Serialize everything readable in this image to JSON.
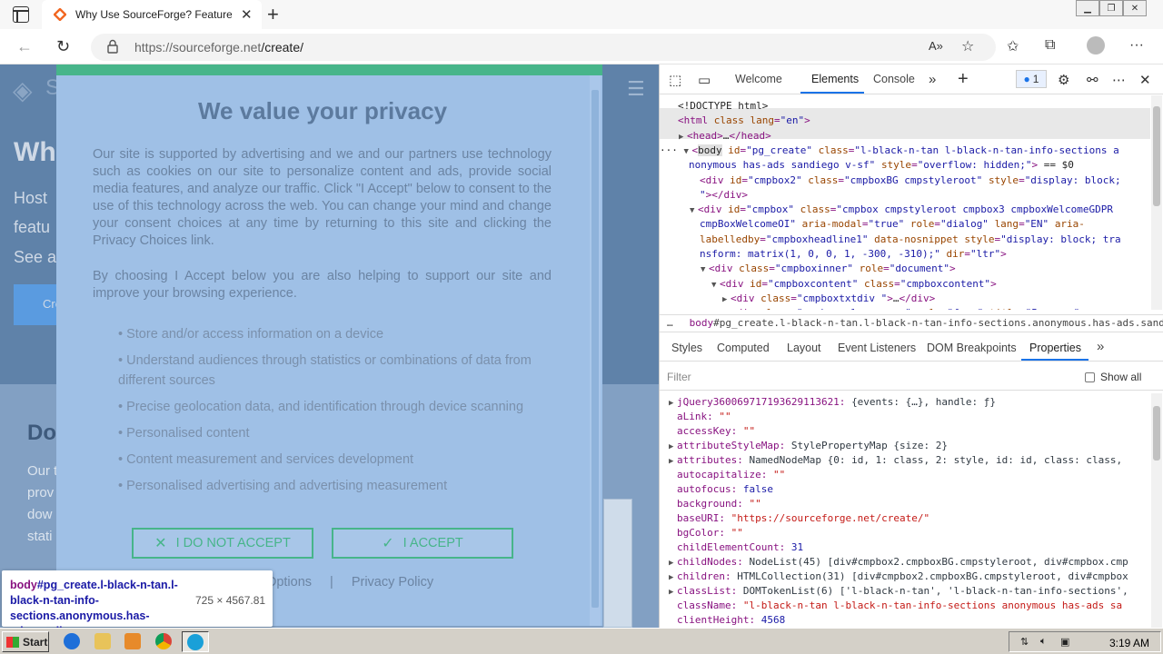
{
  "browser": {
    "tab_title": "Why Use SourceForge? Features a",
    "url_domain": "https://sourceforge.net",
    "url_path": "/create/"
  },
  "page_background": {
    "snippets": [
      "Wh",
      "Host",
      "featu",
      "See a",
      "Cre",
      "Do",
      "Our t",
      "prov",
      "dow",
      "stati",
      "S"
    ]
  },
  "consent": {
    "title": "We value your privacy",
    "paragraph1": "Our site is supported by advertising and we and our partners use technology such as cookies on our site to personalize content and ads, provide social media features, and analyze our traffic. Click \"I Accept\" below to consent to the use of this technology across the web. You can change your mind and change your consent choices at any time by returning to this site and clicking the Privacy Choices link.",
    "paragraph2": "By choosing I Accept below you are also helping to support our site and improve your browsing experience.",
    "purposes": [
      "Store and/or access information on a device",
      "Understand audiences through statistics or combinations of data from different sources",
      "Precise geolocation data, and identification through device scanning",
      "Personalised content",
      "Content measurement and services development",
      "Personalised advertising and advertising measurement"
    ],
    "reject_label": "I DO NOT ACCEPT",
    "accept_label": "I ACCEPT",
    "more_options": "More Options",
    "separator": "|",
    "privacy_policy": "Privacy Policy"
  },
  "inspect_tooltip": {
    "selector_tag": "body",
    "selector_rest": "#pg_create.l-black-n-tan.l-black-n-tan-info-sections.anonymous.has-ads.sandiego...",
    "dimensions": "725 × 4567.81"
  },
  "devtools": {
    "tabs": [
      "Welcome",
      "Elements",
      "Console"
    ],
    "active_tab": "Elements",
    "issues_count": "1",
    "dom_lines": [
      {
        "indent": 0,
        "arrow": "",
        "parts": [
          [
            "tx",
            "<!DOCTYPE html>"
          ]
        ]
      },
      {
        "indent": 0,
        "arrow": "",
        "parts": [
          [
            "tag",
            "<html "
          ],
          [
            "an",
            "class"
          ],
          [
            "tag",
            " "
          ],
          [
            "an",
            "lang"
          ],
          [
            "tag",
            "="
          ],
          [
            "av",
            "\"en\""
          ],
          [
            "tag",
            ">"
          ]
        ]
      },
      {
        "indent": 1,
        "arrow": "▶",
        "parts": [
          [
            "tag",
            "<head>"
          ],
          [
            "tx",
            "…"
          ],
          [
            "tag",
            "</head>"
          ]
        ]
      },
      {
        "indent": 1,
        "arrow": "▼",
        "parts": [
          [
            "tag",
            "<"
          ],
          [
            "hl",
            "body"
          ],
          [
            "tag",
            " "
          ],
          [
            "an",
            "id"
          ],
          [
            "tag",
            "="
          ],
          [
            "av",
            "\"pg_create\""
          ],
          [
            "tag",
            " "
          ],
          [
            "an",
            "class"
          ],
          [
            "tag",
            "="
          ],
          [
            "av",
            "\"l-black-n-tan l-black-n-tan-info-sections  a"
          ]
        ]
      },
      {
        "indent": 1,
        "arrow": "",
        "parts": [
          [
            "av",
            "nonymous has-ads sandiego v-sf\""
          ],
          [
            "tag",
            " "
          ],
          [
            "an",
            "style"
          ],
          [
            "tag",
            "="
          ],
          [
            "av",
            "\"overflow: hidden;\""
          ],
          [
            "tag",
            ">"
          ],
          [
            "tx",
            " == $0"
          ]
        ]
      },
      {
        "indent": 2,
        "arrow": "",
        "parts": [
          [
            "tag",
            "<div "
          ],
          [
            "an",
            "id"
          ],
          [
            "tag",
            "="
          ],
          [
            "av",
            "\"cmpbox2\""
          ],
          [
            "tag",
            " "
          ],
          [
            "an",
            "class"
          ],
          [
            "tag",
            "="
          ],
          [
            "av",
            "\"cmpboxBG cmpstyleroot\""
          ],
          [
            "tag",
            " "
          ],
          [
            "an",
            "style"
          ],
          [
            "tag",
            "="
          ],
          [
            "av",
            "\"display: block;"
          ]
        ]
      },
      {
        "indent": 2,
        "arrow": "",
        "parts": [
          [
            "av",
            "\""
          ],
          [
            "tag",
            "></div>"
          ]
        ]
      },
      {
        "indent": 2,
        "arrow": "▼",
        "parts": [
          [
            "tag",
            "<div "
          ],
          [
            "an",
            "id"
          ],
          [
            "tag",
            "="
          ],
          [
            "av",
            "\"cmpbox\""
          ],
          [
            "tag",
            " "
          ],
          [
            "an",
            "class"
          ],
          [
            "tag",
            "="
          ],
          [
            "av",
            "\"cmpbox cmpstyleroot cmpbox3 cmpboxWelcomeGDPR"
          ]
        ]
      },
      {
        "indent": 2,
        "arrow": "",
        "parts": [
          [
            "av",
            "cmpBoxWelcomeOI\""
          ],
          [
            "tag",
            " "
          ],
          [
            "an",
            "aria-modal"
          ],
          [
            "tag",
            "="
          ],
          [
            "av",
            "\"true\""
          ],
          [
            "tag",
            " "
          ],
          [
            "an",
            "role"
          ],
          [
            "tag",
            "="
          ],
          [
            "av",
            "\"dialog\""
          ],
          [
            "tag",
            " "
          ],
          [
            "an",
            "lang"
          ],
          [
            "tag",
            "="
          ],
          [
            "av",
            "\"EN\""
          ],
          [
            "tag",
            " "
          ],
          [
            "an",
            "aria-"
          ]
        ]
      },
      {
        "indent": 2,
        "arrow": "",
        "parts": [
          [
            "an",
            "labelledby"
          ],
          [
            "tag",
            "="
          ],
          [
            "av",
            "\"cmpboxheadline1\""
          ],
          [
            "tag",
            " "
          ],
          [
            "an",
            "data-nosnippet"
          ],
          [
            "tag",
            " "
          ],
          [
            "an",
            "style"
          ],
          [
            "tag",
            "="
          ],
          [
            "av",
            "\"display: block; tra"
          ]
        ]
      },
      {
        "indent": 2,
        "arrow": "",
        "parts": [
          [
            "av",
            "nsform: matrix(1, 0, 0, 1, -300, -310);\""
          ],
          [
            "tag",
            " "
          ],
          [
            "an",
            "dir"
          ],
          [
            "tag",
            "="
          ],
          [
            "av",
            "\"ltr\""
          ],
          [
            "tag",
            ">"
          ]
        ]
      },
      {
        "indent": 3,
        "arrow": "▼",
        "parts": [
          [
            "tag",
            "<div "
          ],
          [
            "an",
            "class"
          ],
          [
            "tag",
            "="
          ],
          [
            "av",
            "\"cmpboxinner\""
          ],
          [
            "tag",
            " "
          ],
          [
            "an",
            "role"
          ],
          [
            "tag",
            "="
          ],
          [
            "av",
            "\"document\""
          ],
          [
            "tag",
            ">"
          ]
        ]
      },
      {
        "indent": 4,
        "arrow": "▼",
        "parts": [
          [
            "tag",
            "<div "
          ],
          [
            "an",
            "id"
          ],
          [
            "tag",
            "="
          ],
          [
            "av",
            "\"cmpboxcontent\""
          ],
          [
            "tag",
            " "
          ],
          [
            "an",
            "class"
          ],
          [
            "tag",
            "="
          ],
          [
            "av",
            "\"cmpboxcontent\""
          ],
          [
            "tag",
            ">"
          ]
        ]
      },
      {
        "indent": 5,
        "arrow": "▶",
        "parts": [
          [
            "tag",
            "<div "
          ],
          [
            "an",
            "class"
          ],
          [
            "tag",
            "="
          ],
          [
            "av",
            "\"cmpboxtxtdiv \""
          ],
          [
            "tag",
            ">"
          ],
          [
            "tx",
            "…"
          ],
          [
            "tag",
            "</div>"
          ]
        ]
      },
      {
        "indent": 5,
        "arrow": "▼",
        "parts": [
          [
            "tag",
            "<div "
          ],
          [
            "an",
            "class"
          ],
          [
            "tag",
            "="
          ],
          [
            "av",
            "\"cmpboxwelcomeprps\""
          ],
          [
            "tag",
            " "
          ],
          [
            "an",
            "role"
          ],
          [
            "tag",
            "="
          ],
          [
            "av",
            "\"form\""
          ],
          [
            "tag",
            " "
          ],
          [
            "an",
            "title"
          ],
          [
            "tag",
            "="
          ],
          [
            "av",
            "\"Purpose\""
          ],
          [
            "tag",
            ">"
          ]
        ]
      }
    ],
    "breadcrumb_tag": "body",
    "breadcrumb_rest": "#pg_create.l-black-n-tan.l-black-n-tan-info-sections.anonymous.has-ads.sandiego.v-sf",
    "subtabs": [
      "Styles",
      "Computed",
      "Layout",
      "Event Listeners",
      "DOM Breakpoints",
      "Properties"
    ],
    "active_subtab": "Properties",
    "filter_placeholder": "Filter",
    "show_all_label": "Show all",
    "properties": [
      {
        "arrow": "▶",
        "key": "jQuery360069717193629113621",
        "value": "{events: {…}, handle: ƒ}",
        "vt": "pn"
      },
      {
        "arrow": "",
        "key": "aLink",
        "value": "\"\"",
        "vt": "ps"
      },
      {
        "arrow": "",
        "key": "accessKey",
        "value": "\"\"",
        "vt": "ps"
      },
      {
        "arrow": "▶",
        "key": "attributeStyleMap",
        "value": "StylePropertyMap {size: 2}",
        "vt": "pn"
      },
      {
        "arrow": "▶",
        "key": "attributes",
        "value": "NamedNodeMap {0: id, 1: class, 2: style, id: id, class: class,",
        "vt": "pn"
      },
      {
        "arrow": "",
        "key": "autocapitalize",
        "value": "\"\"",
        "vt": "ps"
      },
      {
        "arrow": "",
        "key": "autofocus",
        "value": "false",
        "vt": "pv"
      },
      {
        "arrow": "",
        "key": "background",
        "value": "\"\"",
        "vt": "ps"
      },
      {
        "arrow": "",
        "key": "baseURI",
        "value": "\"https://sourceforge.net/create/\"",
        "vt": "ps"
      },
      {
        "arrow": "",
        "key": "bgColor",
        "value": "\"\"",
        "vt": "ps"
      },
      {
        "arrow": "",
        "key": "childElementCount",
        "value": "31",
        "vt": "pv"
      },
      {
        "arrow": "▶",
        "key": "childNodes",
        "value": "NodeList(45) [div#cmpbox2.cmpboxBG.cmpstyleroot, div#cmpbox.cmp",
        "vt": "pn"
      },
      {
        "arrow": "▶",
        "key": "children",
        "value": "HTMLCollection(31) [div#cmpbox2.cmpboxBG.cmpstyleroot, div#cmpbox",
        "vt": "pn"
      },
      {
        "arrow": "▶",
        "key": "classList",
        "value": "DOMTokenList(6) ['l-black-n-tan', 'l-black-n-tan-info-sections',",
        "vt": "pn"
      },
      {
        "arrow": "",
        "key": "className",
        "value": "\"l-black-n-tan l-black-n-tan-info-sections anonymous has-ads sa",
        "vt": "ps"
      },
      {
        "arrow": "",
        "key": "clientHeight",
        "value": "4568",
        "vt": "pv"
      }
    ]
  },
  "taskbar": {
    "start_label": "Start",
    "clock": "3:19 AM"
  },
  "colors": {
    "accent_green": "#47b58a",
    "devtools_blue": "#1a73e8"
  }
}
